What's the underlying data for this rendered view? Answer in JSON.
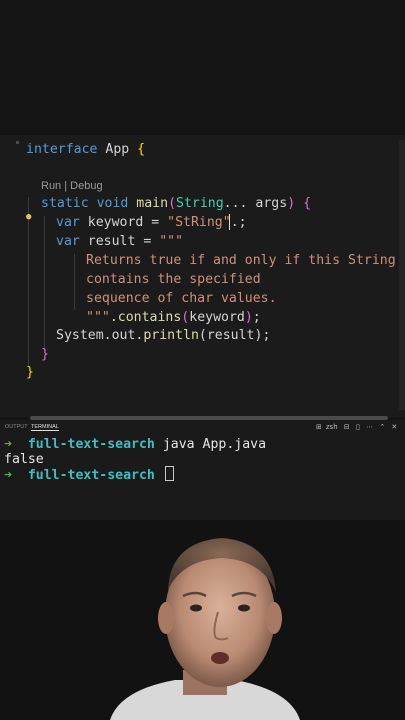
{
  "editor": {
    "codelens": "Run | Debug",
    "lines": {
      "l1_kw": "interface",
      "l1_name": " App ",
      "l1_brace": "{",
      "l2_kw": "static void",
      "l2_fn": "main",
      "l2_open": "(",
      "l2_type": "String",
      "l2_rest": "... args",
      "l2_close": ")",
      "l2_brace": " {",
      "l3_kw": "var",
      "l3_var": " keyword = ",
      "l3_str": "\"StRing\"",
      "l3_end": ".;",
      "l4_kw": "var",
      "l4_var": " result = ",
      "l4_str": "\"\"\"",
      "l5": "Returns true if and only if this String",
      "l6": "contains the specified",
      "l7": "sequence of char values.",
      "l8_str": "\"\"\"",
      "l8_call": ".contains",
      "l8_open": "(",
      "l8_arg": "keyword",
      "l8_close": ")",
      "l8_semi": ";",
      "l9_obj": "System.out.",
      "l9_fn": "println",
      "l9_args": "(result);",
      "l10_brace": "}",
      "l11_brace": "}"
    }
  },
  "panel": {
    "tabs": [
      "OUTPUT",
      "TERMINAL"
    ],
    "active_tab": "TERMINAL",
    "shell_label": "zsh",
    "icons": [
      "plus-icon",
      "split-icon",
      "trash-icon",
      "more-icon",
      "chevron-up-icon",
      "close-icon"
    ]
  },
  "terminal": {
    "prompt_arrow": "➜",
    "dir": "full-text-search",
    "command1": " java App.java",
    "output1": "false",
    "command2": ""
  },
  "colors": {
    "keyword": "#569cd6",
    "function": "#dcdcaa",
    "type": "#4ec9b0",
    "string": "#ce9178",
    "bracket": "#ffd700",
    "prompt_arrow": "#3fb950",
    "prompt_dir": "#3fbfbf"
  }
}
